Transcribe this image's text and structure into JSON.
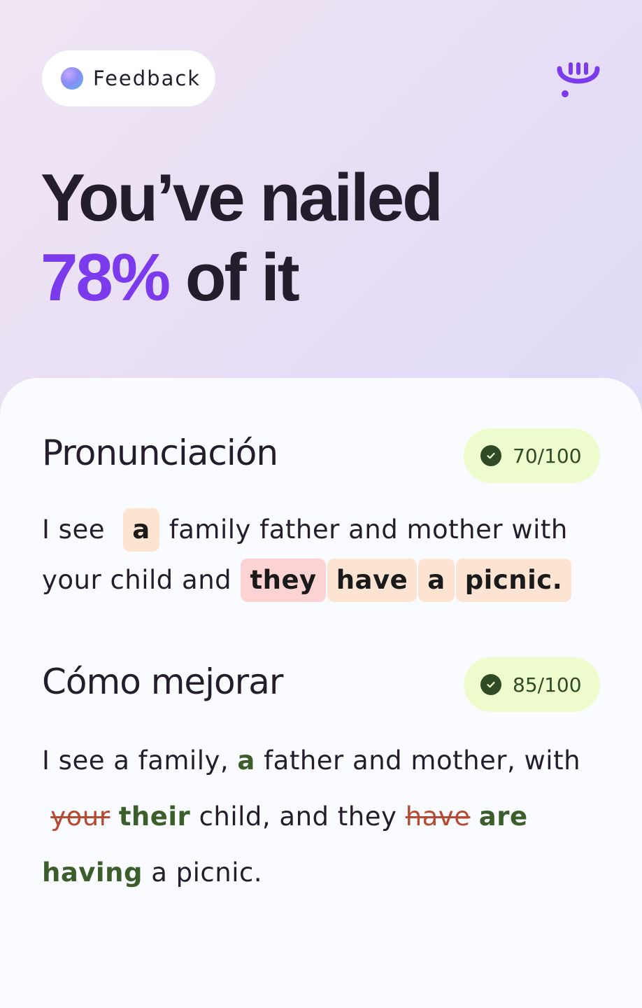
{
  "header": {
    "pill_label": "Feedback",
    "headline_line1": "You’ve nailed",
    "headline_pct": "78%",
    "headline_rest": "of it"
  },
  "colors": {
    "accent": "#7c3aed",
    "score_bg": "#eefccd",
    "score_text": "#2f4a25",
    "chip_peach": "#fde4d2",
    "chip_red": "#fcd2d2",
    "added": "#3b5e2b",
    "removed": "#b54a33"
  },
  "icons": {
    "logo": "smiley-logo-icon",
    "orb": "gradient-orb-icon",
    "check": "check-circle-icon"
  },
  "pronunciation": {
    "title": "Pronunciación",
    "score": "70/100",
    "t1": "I see",
    "w_a1": "a",
    "t2": "family father and mother with your child and",
    "w_they": "they",
    "w_have": "have",
    "w_a2": "a",
    "w_picnic": "picnic."
  },
  "improve": {
    "title": "Cómo mejorar",
    "score": "85/100",
    "t1": "I see a family,",
    "add1": "a",
    "t2": "father and mother, with",
    "del1": "your",
    "add2": "their",
    "t3": "child, and they",
    "del2": "have",
    "add3": "are having",
    "t4": "a picnic."
  }
}
